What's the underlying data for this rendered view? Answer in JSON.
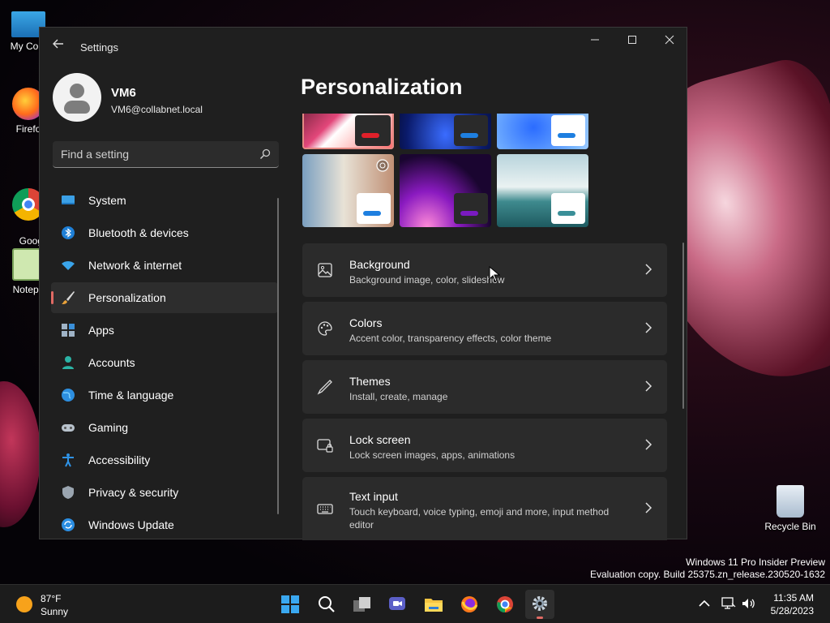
{
  "desktop": {
    "icons": [
      {
        "label": "My Com"
      },
      {
        "label": "Firefo"
      },
      {
        "label": "Goog\nChrom"
      },
      {
        "label": "Notepa"
      },
      {
        "label": "Recycle Bin"
      }
    ]
  },
  "window": {
    "title": "Settings",
    "controls": {
      "minimize": "—",
      "maximize": "☐",
      "close": "✕"
    }
  },
  "profile": {
    "name": "VM6",
    "email": "VM6@collabnet.local"
  },
  "search": {
    "placeholder": "Find a setting"
  },
  "sidebar": {
    "items": [
      {
        "label": "System",
        "icon": "system-icon"
      },
      {
        "label": "Bluetooth & devices",
        "icon": "bluetooth-icon"
      },
      {
        "label": "Network & internet",
        "icon": "wifi-icon"
      },
      {
        "label": "Personalization",
        "icon": "brush-icon",
        "active": true
      },
      {
        "label": "Apps",
        "icon": "apps-icon"
      },
      {
        "label": "Accounts",
        "icon": "accounts-icon"
      },
      {
        "label": "Time & language",
        "icon": "globe-icon"
      },
      {
        "label": "Gaming",
        "icon": "gamepad-icon"
      },
      {
        "label": "Accessibility",
        "icon": "accessibility-icon"
      },
      {
        "label": "Privacy & security",
        "icon": "shield-icon"
      },
      {
        "label": "Windows Update",
        "icon": "update-icon"
      }
    ]
  },
  "main": {
    "title": "Personalization",
    "cards": [
      {
        "title": "Background",
        "subtitle": "Background image, color, slideshow",
        "icon": "image-icon"
      },
      {
        "title": "Colors",
        "subtitle": "Accent color, transparency effects, color theme",
        "icon": "palette-icon"
      },
      {
        "title": "Themes",
        "subtitle": "Install, create, manage",
        "icon": "pen-icon"
      },
      {
        "title": "Lock screen",
        "subtitle": "Lock screen images, apps, animations",
        "icon": "lock-screen-icon"
      },
      {
        "title": "Text input",
        "subtitle": "Touch keyboard, voice typing, emoji and more, input method editor",
        "icon": "keyboard-icon"
      }
    ]
  },
  "watermark": {
    "line1": "Windows 11 Pro Insider Preview",
    "line2": "Evaluation copy. Build 25375.zn_release.230520-1632"
  },
  "taskbar": {
    "weather": {
      "temp": "87°F",
      "condition": "Sunny"
    },
    "clock": {
      "time": "11:35 AM",
      "date": "5/28/2023"
    }
  },
  "colors": {
    "accent": "#e06a64",
    "window_bg": "#1f1f1f",
    "card_bg": "#2b2b2b"
  }
}
